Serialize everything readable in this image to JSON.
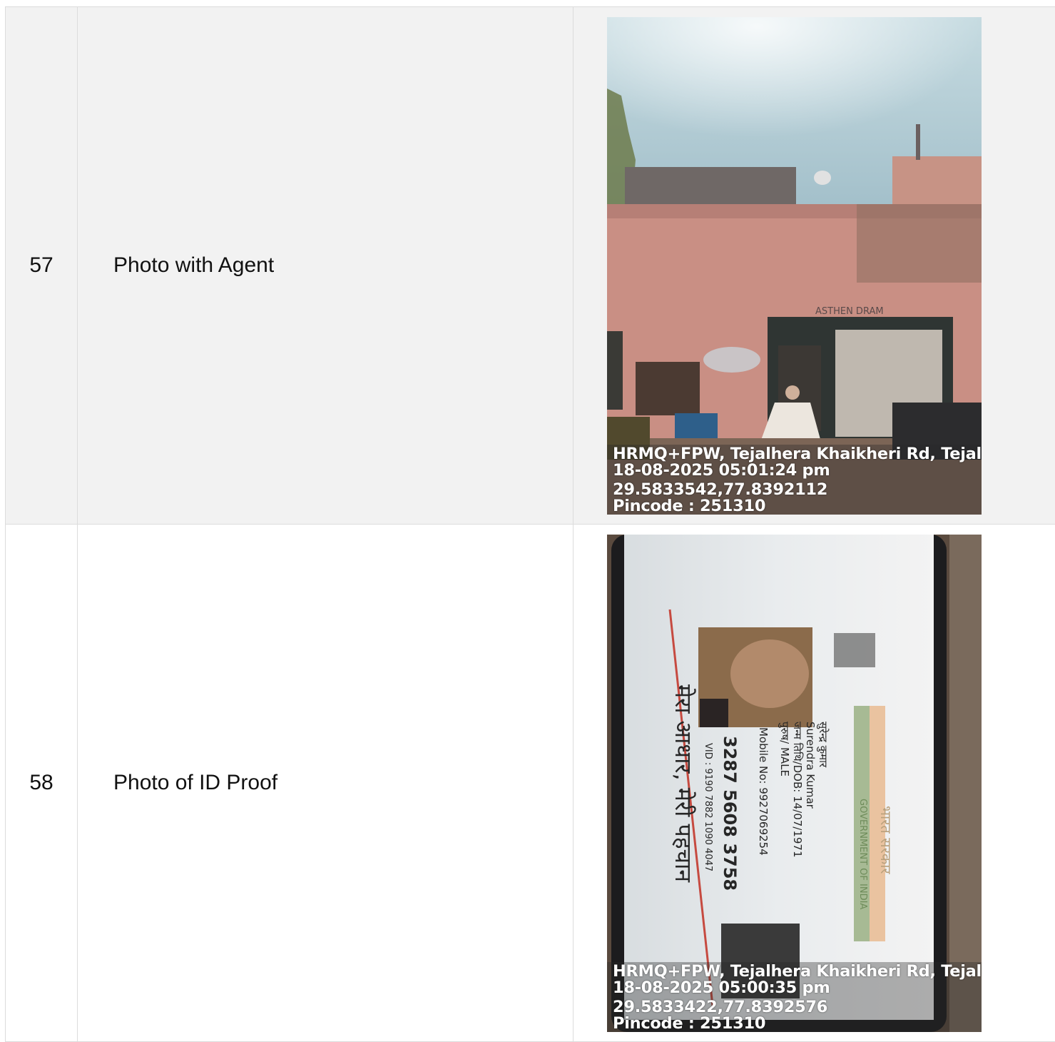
{
  "rows": [
    {
      "number": "57",
      "label": "Photo with Agent",
      "photo": {
        "overlay": [
          "HRMQ+FPW, Tejalhera Khaikheri Rd, Tejalhe",
          "18-08-2025 05:01:24 pm",
          "29.5833542,77.8392112",
          "Pincode : 251310"
        ],
        "sign_text": "ASTHEN DRAM"
      }
    },
    {
      "number": "58",
      "label": "Photo of ID Proof",
      "photo": {
        "overlay": [
          "HRMQ+FPW, Tejalhera Khaikheri Rd, Tejalhe",
          "18-08-2025 05:00:35 pm",
          "29.5833422,77.8392576",
          "Pincode : 251310"
        ],
        "card": {
          "gov_hindi": "भारत सरकार",
          "gov_english": "GOVERNMENT OF INDIA",
          "name_hindi": "सुरेन्द्र कुमार",
          "name_english": "Surendra Kumar",
          "dob": "जन्म तिथि/DOB: 14/07/1971",
          "gender": "पुरुष/ MALE",
          "mobile": "Mobile No: 9927069254",
          "aadhaar_number": "3287 5608 3758",
          "vid": "VID : 9190 7882 1090 4047",
          "tagline": "मेरा आधार, मेरी पहचान"
        }
      }
    }
  ]
}
